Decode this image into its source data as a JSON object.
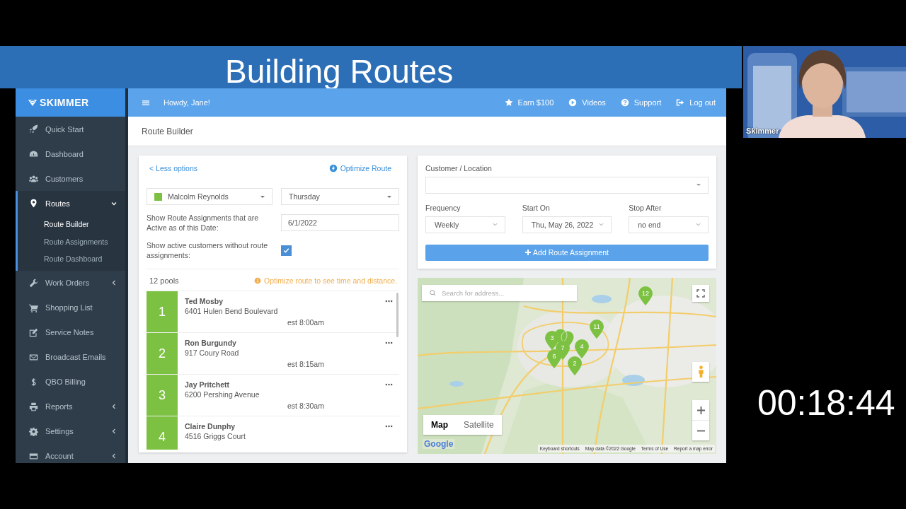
{
  "banner": {
    "title": "Building Routes"
  },
  "webcam": {
    "name": "Skimmer"
  },
  "timer": "00:18:44",
  "app": {
    "brand": "SKIMMER",
    "sidebar": {
      "items": [
        {
          "label": "Quick Start",
          "selected": false
        },
        {
          "label": "Dashboard",
          "selected": false
        },
        {
          "label": "Customers",
          "selected": false
        },
        {
          "label": "Routes",
          "selected": true,
          "expanded": true,
          "children": [
            {
              "label": "Route Builder",
              "selected": true
            },
            {
              "label": "Route Assignments",
              "selected": false
            },
            {
              "label": "Route Dashboard",
              "selected": false
            }
          ]
        },
        {
          "label": "Work Orders",
          "selected": false,
          "expanded": false
        },
        {
          "label": "Shopping List",
          "selected": false
        },
        {
          "label": "Service Notes",
          "selected": false
        },
        {
          "label": "Broadcast Emails",
          "selected": false
        },
        {
          "label": "QBO Billing",
          "selected": false
        },
        {
          "label": "Reports",
          "selected": false,
          "expanded": false
        },
        {
          "label": "Settings",
          "selected": false,
          "expanded": false
        },
        {
          "label": "Account",
          "selected": false,
          "expanded": false
        }
      ]
    },
    "topbar": {
      "greeting": "Howdy, Jane!",
      "links": [
        {
          "label": "Earn $100"
        },
        {
          "label": "Videos"
        },
        {
          "label": "Support"
        },
        {
          "label": "Log out"
        }
      ]
    },
    "page_title": "Route Builder",
    "route_panel": {
      "less_options": "< Less options",
      "optimize": "Optimize Route",
      "technician": {
        "value": "Malcolm Reynolds",
        "color": "#7dc142"
      },
      "day": {
        "value": "Thursday"
      },
      "active_date": {
        "label": "Show Route Assignments that are Active as of this Date:",
        "value": "6/1/2022"
      },
      "show_unassigned": {
        "label": "Show active customers without route assignments:",
        "checked": true
      },
      "count": "12 pools",
      "notice": "Optimize route to see time and distance.",
      "stops": [
        {
          "number": "1",
          "name": "Ted Mosby",
          "address": "6401 Hulen Bend Boulevard",
          "eta": "est 8:00am"
        },
        {
          "number": "2",
          "name": "Ron Burgundy",
          "address": "917 Coury Road",
          "eta": "est 8:15am"
        },
        {
          "number": "3",
          "name": "Jay Pritchett",
          "address": "6200 Pershing Avenue",
          "eta": "est 8:30am"
        },
        {
          "number": "4",
          "name": "Claire Dunphy",
          "address": "4516 Griggs Court"
        }
      ]
    },
    "assignment_form": {
      "customer": {
        "label": "Customer / Location"
      },
      "frequency": {
        "label": "Frequency",
        "value": "Weekly"
      },
      "start_on": {
        "label": "Start On",
        "value": "Thu, May 26, 2022"
      },
      "stop_after": {
        "label": "Stop After",
        "value": "no end"
      },
      "button": "Add Route Assignment"
    },
    "map": {
      "search": {
        "placeholder": "Search for address..."
      },
      "types": [
        {
          "label": "Map",
          "selected": true
        },
        {
          "label": "Satellite",
          "selected": false
        }
      ],
      "markers": [
        {
          "label": "12"
        },
        {
          "label": "11"
        },
        {
          "label": "3"
        },
        {
          "label": "7"
        },
        {
          "label": "4"
        },
        {
          "label": "6"
        },
        {
          "label": "2"
        }
      ],
      "logo": "Google",
      "footer": [
        "Keyboard shortcuts",
        "Map data ©2022 Google",
        "Terms of Use",
        "Report a map error"
      ]
    }
  }
}
